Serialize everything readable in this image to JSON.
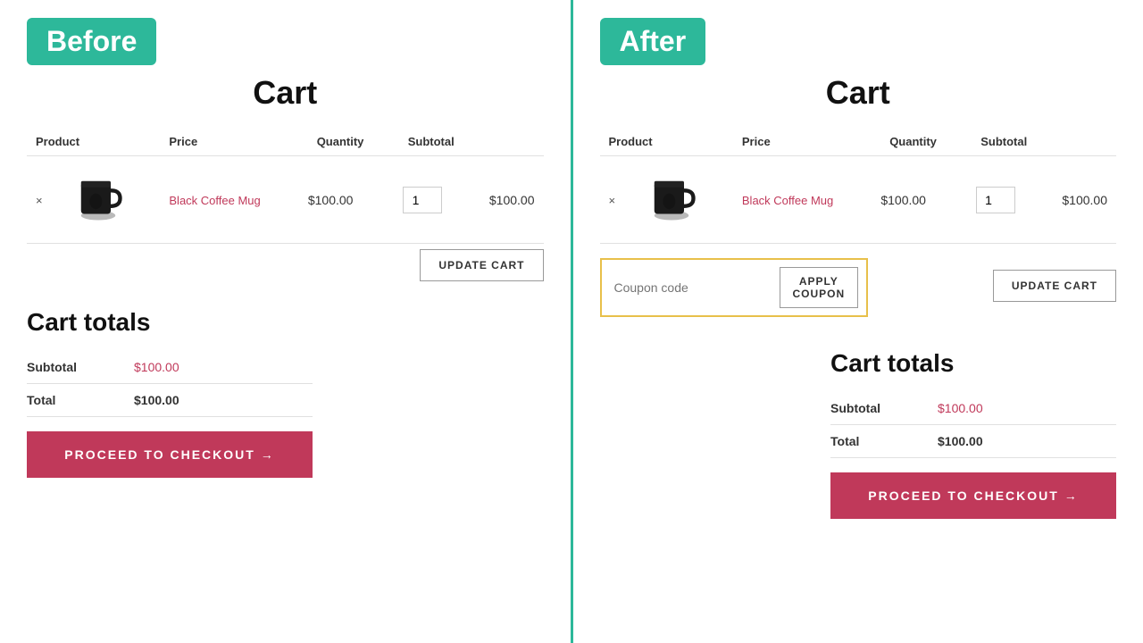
{
  "before": {
    "badge": "Before",
    "cart_title": "Cart",
    "table": {
      "headers": [
        "Product",
        "Price",
        "Quantity",
        "Subtotal"
      ],
      "row": {
        "remove": "×",
        "product_name": "Black Coffee Mug",
        "price": "$100.00",
        "qty": "1",
        "subtotal": "$100.00"
      }
    },
    "update_cart": "UPDATE CART",
    "cart_totals_title": "Cart totals",
    "subtotal_label": "Subtotal",
    "subtotal_value": "$100.00",
    "total_label": "Total",
    "total_value": "$100.00",
    "checkout_btn": "PROCEED TO CHECKOUT →"
  },
  "after": {
    "badge": "After",
    "cart_title": "Cart",
    "table": {
      "headers": [
        "Product",
        "Price",
        "Quantity",
        "Subtotal"
      ],
      "row": {
        "remove": "×",
        "product_name": "Black Coffee Mug",
        "price": "$100.00",
        "qty": "1",
        "subtotal": "$100.00"
      }
    },
    "coupon_placeholder": "Coupon code",
    "apply_coupon": "APPLY COUPON",
    "update_cart": "UPDATE CART",
    "cart_totals_title": "Cart totals",
    "subtotal_label": "Subtotal",
    "subtotal_value": "$100.00",
    "total_label": "Total",
    "total_value": "$100.00",
    "checkout_btn": "PROCEED TO CHECKOUT →"
  },
  "colors": {
    "accent_teal": "#2db89a",
    "accent_pink": "#c0395a",
    "coupon_border": "#e8c04a"
  }
}
